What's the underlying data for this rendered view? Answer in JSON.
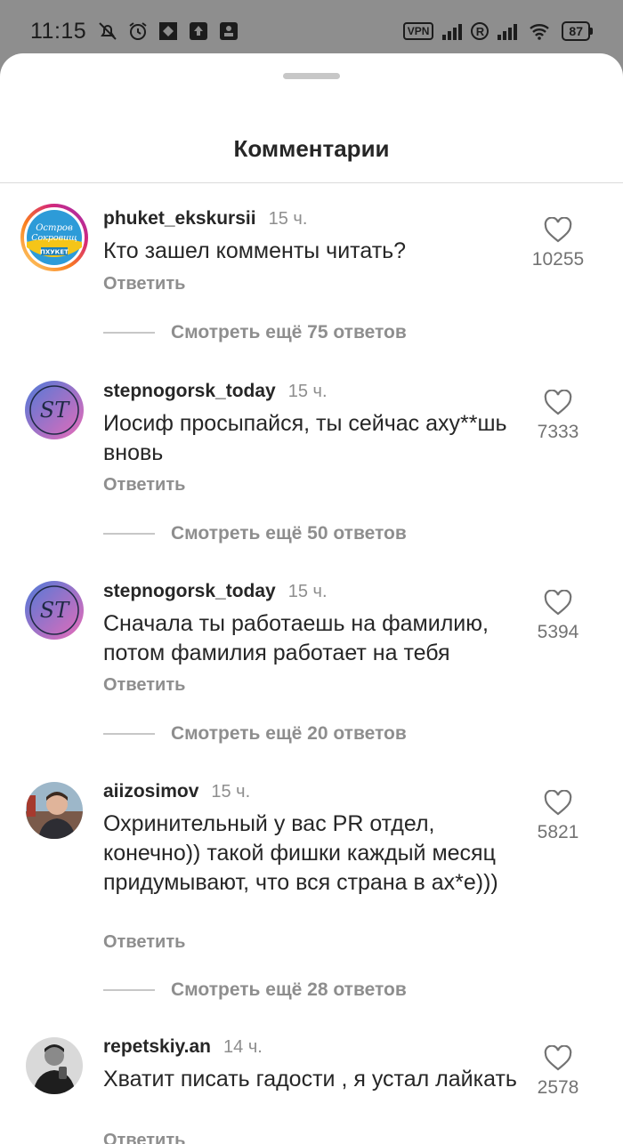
{
  "status_bar": {
    "time": "11:15",
    "vpn_label": "VPN",
    "roaming_label": "R",
    "battery_percent": "87",
    "left_icons": [
      "mute-bell-icon",
      "alarm-clock-icon",
      "app-notification-icon",
      "upload-icon",
      "profile-notification-icon"
    ],
    "right_icons": [
      "vpn-icon",
      "signal-icon",
      "roaming-icon",
      "signal-icon",
      "wifi-icon",
      "battery-icon"
    ]
  },
  "sheet": {
    "title": "Комментарии"
  },
  "comments": [
    {
      "username": "phuket_ekskursii",
      "time": "15 ч.",
      "text": "Кто зашел комменты читать?",
      "reply_label": "Ответить",
      "like_count": "10255",
      "more_replies": "Смотреть ещё 75 ответов",
      "avatar_text": [
        "Остров",
        "Сокровищ",
        "ПХУКЕТ"
      ]
    },
    {
      "username": "stepnogorsk_today",
      "time": "15 ч.",
      "text": "Иосиф просыпайся, ты сейчас аху**шь вновь",
      "reply_label": "Ответить",
      "like_count": "7333",
      "more_replies": "Смотреть ещё 50 ответов",
      "avatar_text": [
        "ST"
      ]
    },
    {
      "username": "stepnogorsk_today",
      "time": "15 ч.",
      "text": "Сначала ты работаешь на фамилию, потом фамилия работает на тебя",
      "reply_label": "Ответить",
      "like_count": "5394",
      "more_replies": "Смотреть ещё 20 ответов",
      "avatar_text": [
        "ST"
      ]
    },
    {
      "username": "aiizosimov",
      "time": "15 ч.",
      "text": "Охринительный у вас PR отдел, конечно)) такой фишки каждый месяц придумывают, что вся страна в ах*е)))",
      "reply_label": "Ответить",
      "like_count": "5821",
      "more_replies": "Смотреть ещё 28 ответов"
    },
    {
      "username": "repetskiy.an",
      "time": "14 ч.",
      "text": "Хватит писать гадости , я устал лайкать",
      "reply_label": "Ответить",
      "like_count": "2578"
    }
  ],
  "colors": {
    "background_dim": "#8e8e8e",
    "sheet": "#ffffff",
    "primary_text": "#262626",
    "secondary_text": "#8e8e8e"
  }
}
